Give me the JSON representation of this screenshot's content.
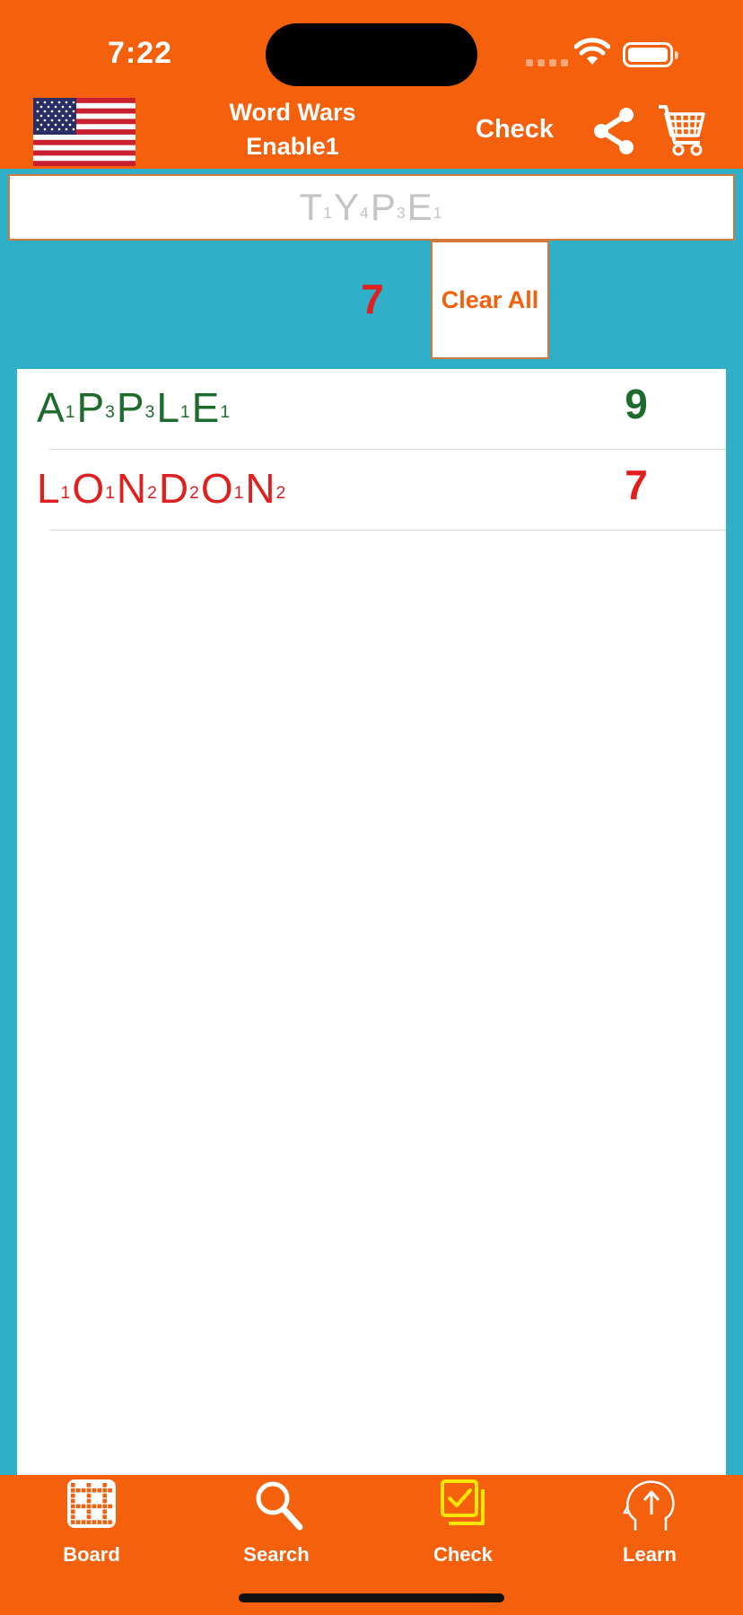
{
  "status": {
    "time": "7:22"
  },
  "header": {
    "title_line1": "Word Wars",
    "title_line2": "Enable1",
    "check_label": "Check"
  },
  "input": {
    "placeholder_tiles": [
      {
        "letter": "T",
        "score": "1"
      },
      {
        "letter": "Y",
        "score": "4"
      },
      {
        "letter": "P",
        "score": "3"
      },
      {
        "letter": "E",
        "score": "1"
      }
    ]
  },
  "total_score": "7",
  "clear_label": "Clear All",
  "words": [
    {
      "tiles": [
        {
          "letter": "A",
          "score": "1"
        },
        {
          "letter": "P",
          "score": "3"
        },
        {
          "letter": "P",
          "score": "3"
        },
        {
          "letter": "L",
          "score": "1"
        },
        {
          "letter": "E",
          "score": "1"
        }
      ],
      "score": "9",
      "color": "#1e6b2e"
    },
    {
      "tiles": [
        {
          "letter": "L",
          "score": "1"
        },
        {
          "letter": "O",
          "score": "1"
        },
        {
          "letter": "N",
          "score": "2"
        },
        {
          "letter": "D",
          "score": "2"
        },
        {
          "letter": "O",
          "score": "1"
        },
        {
          "letter": "N",
          "score": "2"
        }
      ],
      "score": "7",
      "color": "#e01f1f"
    }
  ],
  "tabs": [
    {
      "label": "Board",
      "icon": "board-grid-icon",
      "active": false
    },
    {
      "label": "Search",
      "icon": "search-icon",
      "active": false
    },
    {
      "label": "Check",
      "icon": "check-stack-icon",
      "active": true
    },
    {
      "label": "Learn",
      "icon": "learn-head-icon",
      "active": false
    }
  ],
  "colors": {
    "brand_orange": "#f4600c",
    "background_teal": "#2fb0c8",
    "valid_green": "#1e6b2e",
    "invalid_red": "#e01f1f",
    "active_tab_yellow": "#ffe600"
  }
}
